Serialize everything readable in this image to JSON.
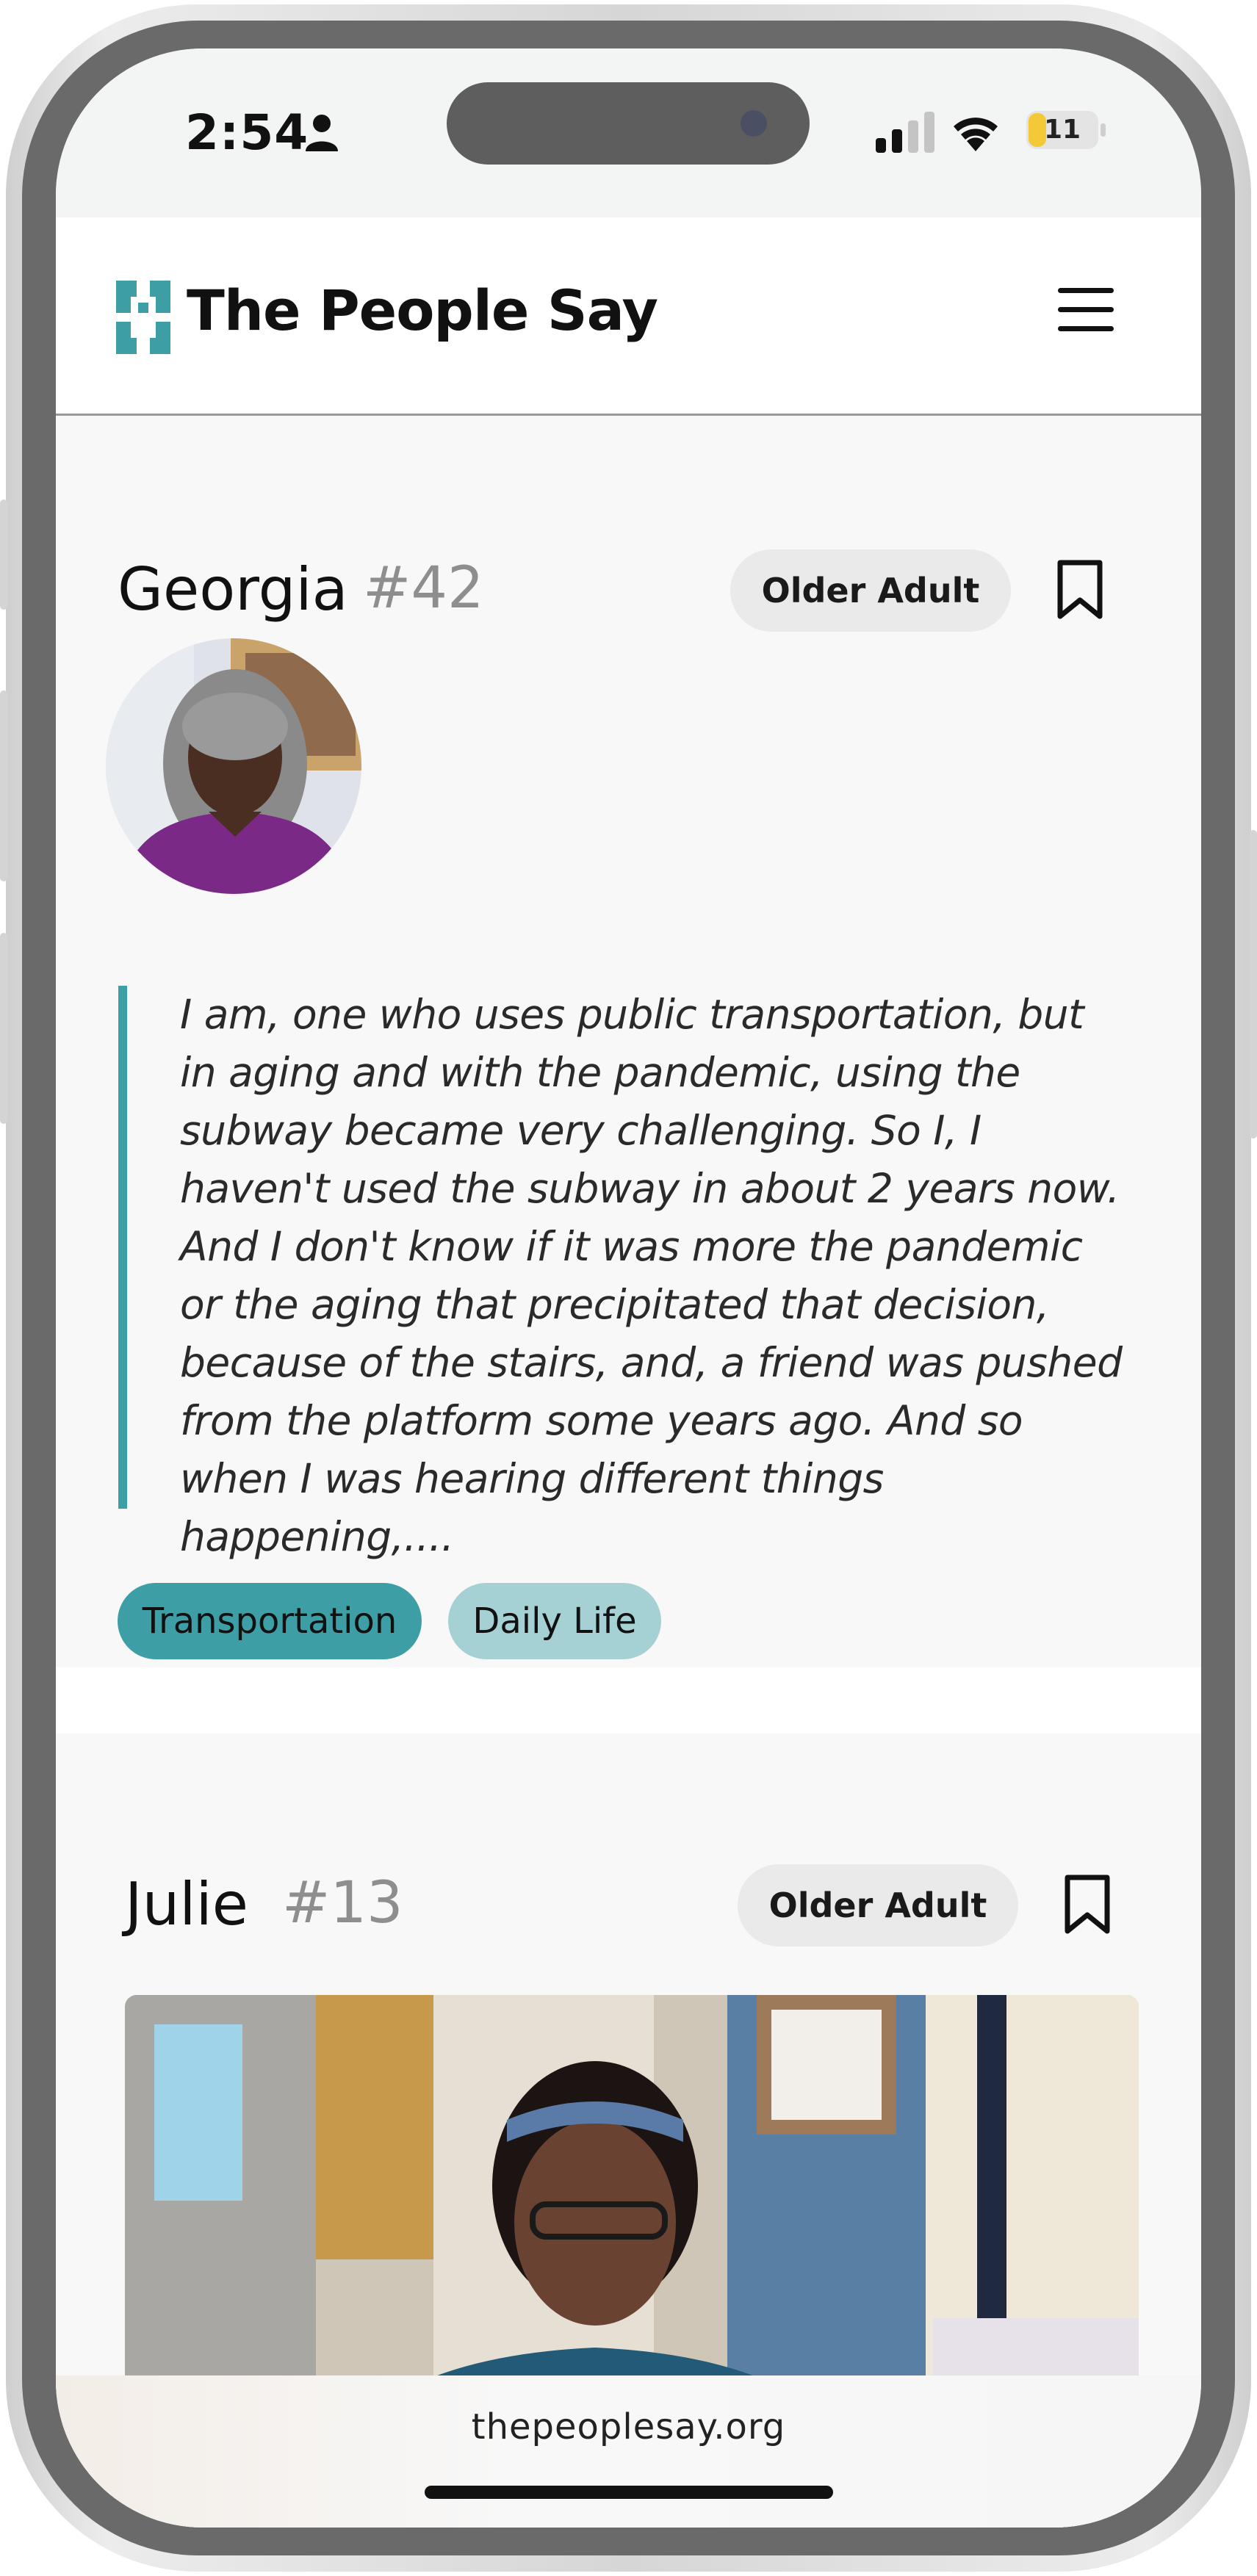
{
  "status_bar": {
    "time": "2:54",
    "battery_level": "11",
    "icons": [
      "person-icon",
      "cellular-signal-icon",
      "wifi-icon",
      "battery-icon"
    ]
  },
  "header": {
    "brand": "The People Say",
    "logo_icon": "quote-marks-logo-icon",
    "menu_icon": "hamburger-menu-icon",
    "brand_color": "#3e9ea5"
  },
  "cards": [
    {
      "name": "Georgia",
      "number": "#42",
      "category": "Older Adult",
      "bookmark_icon": "bookmark-icon",
      "quote": "I am, one who uses public transportation, but in aging and with the pandemic, using the subway became very challenging. So I, I haven't used the subway in about 2 years now. And I don't know if it was more the pandemic or the aging that precipitated that decision, because of the stairs, and, a friend was pushed from the platform some years ago. And so when I was hearing different things happening,....",
      "tags": [
        "Transportation",
        "Daily Life"
      ]
    },
    {
      "name": "Julie",
      "number": "#13",
      "category": "Older Adult",
      "bookmark_icon": "bookmark-icon"
    }
  ],
  "browser": {
    "url": "thepeoplesay.org"
  },
  "colors": {
    "accent": "#3e9ea5",
    "accent_light": "#a6d1d4",
    "pill_bg": "#e9eae9"
  }
}
